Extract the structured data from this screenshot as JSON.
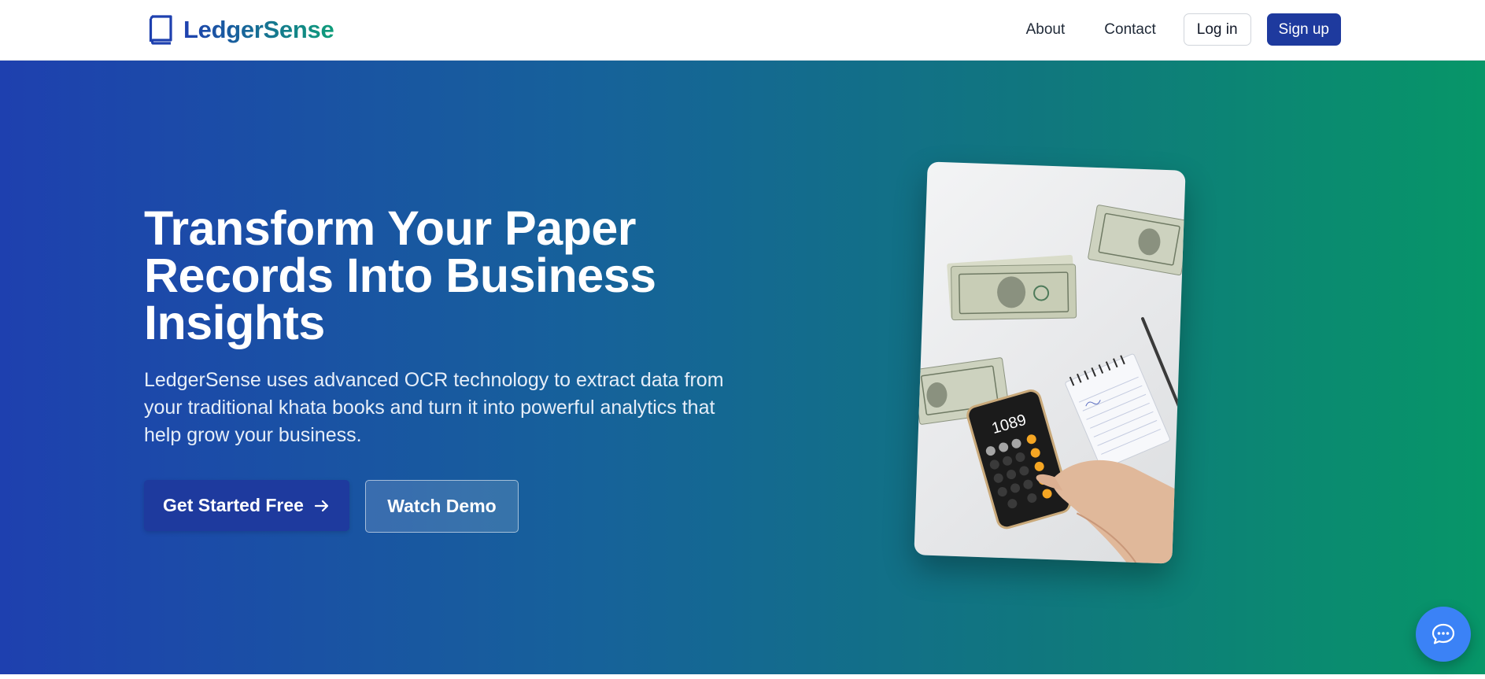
{
  "brand": {
    "name": "LedgerSense",
    "icon": "book-icon"
  },
  "nav": {
    "about": "About",
    "contact": "Contact",
    "login": "Log in",
    "signup": "Sign up"
  },
  "hero": {
    "title": "Transform Your Paper Records Into Business Insights",
    "subtitle": "LedgerSense uses advanced OCR technology to extract data from your traditional khata books and turn it into powerful analytics that help grow your business.",
    "primary_cta": "Get Started Free",
    "primary_cta_icon": "arrow-right-icon",
    "secondary_cta": "Watch Demo",
    "image": {
      "subject": "money-calculator-notepad-photo",
      "calculator_display": "1089"
    }
  },
  "chat": {
    "icon": "chat-bubble-icon"
  },
  "colors": {
    "brand_blue": "#1e3a9e",
    "hero_gradient_start": "#1e40af",
    "hero_gradient_end": "#079668",
    "chat_button": "#3b82f6"
  }
}
